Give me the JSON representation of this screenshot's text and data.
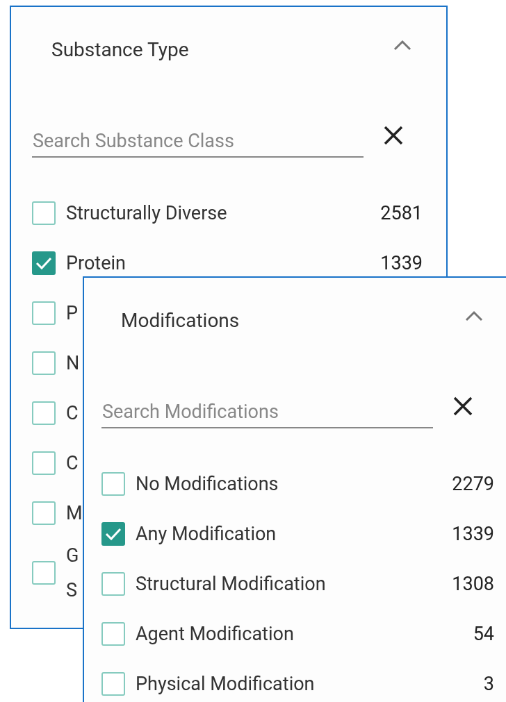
{
  "panels": [
    {
      "title": "Substance Type",
      "expanded": true,
      "search": {
        "placeholder": "Search Substance Class"
      },
      "items": [
        {
          "label": "Structurally Diverse",
          "count": "2581",
          "checked": false
        },
        {
          "label": "Protein",
          "count": "1339",
          "checked": true
        },
        {
          "label": "P",
          "checked": false
        },
        {
          "label": "N",
          "checked": false
        },
        {
          "label": "C",
          "checked": false
        },
        {
          "label": "C",
          "checked": false
        },
        {
          "label": "M",
          "checked": false
        },
        {
          "label": "G S",
          "checked": false
        }
      ]
    },
    {
      "title": "Modifications",
      "expanded": true,
      "search": {
        "placeholder": "Search Modifications"
      },
      "items": [
        {
          "label": "No Modifications",
          "count": "2279",
          "checked": false
        },
        {
          "label": "Any Modification",
          "count": "1339",
          "checked": true
        },
        {
          "label": "Structural Modification",
          "count": "1308",
          "checked": false
        },
        {
          "label": "Agent Modification",
          "count": "54",
          "checked": false
        },
        {
          "label": "Physical Modification",
          "count": "3",
          "checked": false
        }
      ]
    }
  ]
}
